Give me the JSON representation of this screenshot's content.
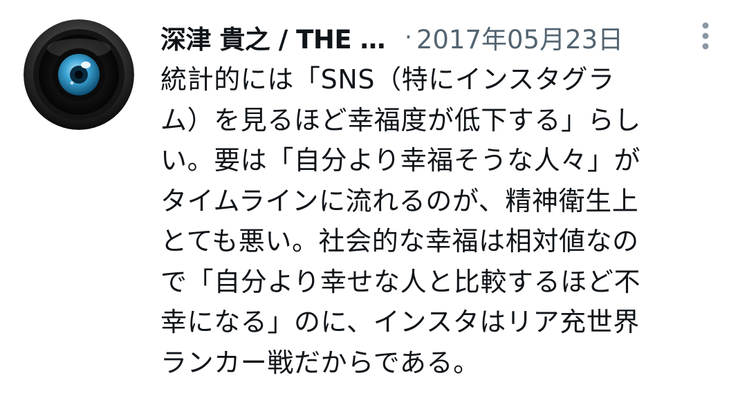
{
  "tweet": {
    "display_name": "深津 貴之 / THE …",
    "separator": "·",
    "date": "2017年05月23日",
    "avatar_icon": "camera-lens-icon",
    "more_icon": "vertical-ellipsis-icon",
    "text_lines": [
      "統計的には「SNS（特にインスタグラ",
      "ム）を見るほど幸福度が低下する」らし",
      "い。要は「自分より幸福そうな人々」が",
      "タイムラインに流れるのが、精神衛生上",
      "とても悪い。社会的な幸福は相対値なの",
      "で「自分より幸せな人と比較するほど不",
      "幸になる」のに、インスタはリア充世界",
      "ランカー戦だからである。"
    ],
    "colors": {
      "text": "#0f1419",
      "secondary": "#536471",
      "lens_blue": "#3da6d6",
      "background": "#ffffff"
    }
  }
}
